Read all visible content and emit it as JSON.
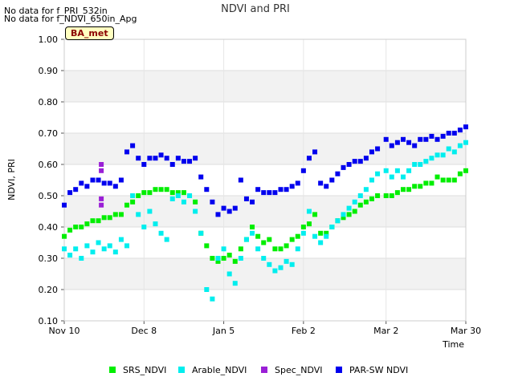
{
  "notes": [
    "No data for f_PRI_532in",
    "No data for f_NDVI_650in_Apg"
  ],
  "site_label": "BA_met",
  "colors": {
    "SRS_NDVI": "#00ee00",
    "Arable_NDVI": "#00eeee",
    "Spec_NDVI": "#9a1fd6",
    "PAR-SW NDVI": "#0000ee"
  },
  "chart_data": {
    "type": "scatter",
    "title": "NDVI and PRI",
    "xlabel": "Time",
    "ylabel": "NDVI, PRI",
    "x_ticks": [
      "Nov 10",
      "Dec 8",
      "Jan 5",
      "Feb 2",
      "Mar 2",
      "Mar 30"
    ],
    "x_range": [
      "Nov 10",
      "Mar 30"
    ],
    "ylim": [
      0.1,
      1.0
    ],
    "y_ticks": [
      "0.10",
      "0.20",
      "0.30",
      "0.40",
      "0.50",
      "0.60",
      "0.70",
      "0.80",
      "0.90",
      "1.00"
    ],
    "grid": true,
    "legend_position": "bottom",
    "series": [
      {
        "name": "SRS_NDVI",
        "points": [
          [
            "Nov 10",
            0.37
          ],
          [
            "Nov 12",
            0.39
          ],
          [
            "Nov 14",
            0.4
          ],
          [
            "Nov 16",
            0.4
          ],
          [
            "Nov 18",
            0.41
          ],
          [
            "Nov 20",
            0.42
          ],
          [
            "Nov 22",
            0.42
          ],
          [
            "Nov 24",
            0.43
          ],
          [
            "Nov 26",
            0.43
          ],
          [
            "Nov 28",
            0.44
          ],
          [
            "Nov 30",
            0.44
          ],
          [
            "Dec 2",
            0.47
          ],
          [
            "Dec 4",
            0.48
          ],
          [
            "Dec 6",
            0.5
          ],
          [
            "Dec 8",
            0.51
          ],
          [
            "Dec 10",
            0.51
          ],
          [
            "Dec 12",
            0.52
          ],
          [
            "Dec 14",
            0.52
          ],
          [
            "Dec 16",
            0.52
          ],
          [
            "Dec 18",
            0.51
          ],
          [
            "Dec 20",
            0.51
          ],
          [
            "Dec 22",
            0.51
          ],
          [
            "Dec 24",
            0.5
          ],
          [
            "Dec 26",
            0.48
          ],
          [
            "Dec 28",
            0.38
          ],
          [
            "Dec 30",
            0.34
          ],
          [
            "Jan 1",
            0.3
          ],
          [
            "Jan 3",
            0.29
          ],
          [
            "Jan 5",
            0.3
          ],
          [
            "Jan 7",
            0.31
          ],
          [
            "Jan 9",
            0.29
          ],
          [
            "Jan 11",
            0.33
          ],
          [
            "Jan 13",
            0.36
          ],
          [
            "Jan 15",
            0.4
          ],
          [
            "Jan 17",
            0.37
          ],
          [
            "Jan 19",
            0.35
          ],
          [
            "Jan 21",
            0.36
          ],
          [
            "Jan 23",
            0.33
          ],
          [
            "Jan 25",
            0.33
          ],
          [
            "Jan 27",
            0.34
          ],
          [
            "Jan 29",
            0.36
          ],
          [
            "Jan 31",
            0.37
          ],
          [
            "Feb 2",
            0.4
          ],
          [
            "Feb 4",
            0.41
          ],
          [
            "Feb 6",
            0.44
          ],
          [
            "Feb 8",
            0.38
          ],
          [
            "Feb 10",
            0.38
          ],
          [
            "Feb 12",
            0.4
          ],
          [
            "Feb 14",
            0.42
          ],
          [
            "Feb 16",
            0.43
          ],
          [
            "Feb 18",
            0.44
          ],
          [
            "Feb 20",
            0.45
          ],
          [
            "Feb 22",
            0.47
          ],
          [
            "Feb 24",
            0.48
          ],
          [
            "Feb 26",
            0.49
          ],
          [
            "Feb 28",
            0.5
          ],
          [
            "Mar 2",
            0.5
          ],
          [
            "Mar 4",
            0.5
          ],
          [
            "Mar 6",
            0.51
          ],
          [
            "Mar 8",
            0.52
          ],
          [
            "Mar 10",
            0.52
          ],
          [
            "Mar 12",
            0.53
          ],
          [
            "Mar 14",
            0.53
          ],
          [
            "Mar 16",
            0.54
          ],
          [
            "Mar 18",
            0.54
          ],
          [
            "Mar 20",
            0.56
          ],
          [
            "Mar 22",
            0.55
          ],
          [
            "Mar 24",
            0.55
          ],
          [
            "Mar 26",
            0.55
          ],
          [
            "Mar 28",
            0.57
          ],
          [
            "Mar 30",
            0.58
          ]
        ]
      },
      {
        "name": "Arable_NDVI",
        "points": [
          [
            "Nov 10",
            0.33
          ],
          [
            "Nov 12",
            0.31
          ],
          [
            "Nov 14",
            0.33
          ],
          [
            "Nov 16",
            0.3
          ],
          [
            "Nov 18",
            0.34
          ],
          [
            "Nov 20",
            0.32
          ],
          [
            "Nov 22",
            0.35
          ],
          [
            "Nov 24",
            0.33
          ],
          [
            "Nov 26",
            0.34
          ],
          [
            "Nov 28",
            0.32
          ],
          [
            "Nov 30",
            0.36
          ],
          [
            "Dec 2",
            0.34
          ],
          [
            "Dec 4",
            0.5
          ],
          [
            "Dec 6",
            0.44
          ],
          [
            "Dec 8",
            0.4
          ],
          [
            "Dec 10",
            0.45
          ],
          [
            "Dec 12",
            0.41
          ],
          [
            "Dec 14",
            0.38
          ],
          [
            "Dec 16",
            0.36
          ],
          [
            "Dec 18",
            0.49
          ],
          [
            "Dec 20",
            0.5
          ],
          [
            "Dec 22",
            0.48
          ],
          [
            "Dec 24",
            0.5
          ],
          [
            "Dec 26",
            0.45
          ],
          [
            "Dec 28",
            0.38
          ],
          [
            "Dec 30",
            0.2
          ],
          [
            "Jan 1",
            0.17
          ],
          [
            "Jan 3",
            0.3
          ],
          [
            "Jan 5",
            0.33
          ],
          [
            "Jan 7",
            0.25
          ],
          [
            "Jan 9",
            0.22
          ],
          [
            "Jan 11",
            0.3
          ],
          [
            "Jan 13",
            0.36
          ],
          [
            "Jan 15",
            0.38
          ],
          [
            "Jan 17",
            0.33
          ],
          [
            "Jan 19",
            0.3
          ],
          [
            "Jan 21",
            0.28
          ],
          [
            "Jan 23",
            0.26
          ],
          [
            "Jan 25",
            0.27
          ],
          [
            "Jan 27",
            0.29
          ],
          [
            "Jan 29",
            0.28
          ],
          [
            "Jan 31",
            0.33
          ],
          [
            "Feb 2",
            0.38
          ],
          [
            "Feb 4",
            0.45
          ],
          [
            "Feb 6",
            0.37
          ],
          [
            "Feb 8",
            0.35
          ],
          [
            "Feb 10",
            0.37
          ],
          [
            "Feb 12",
            0.4
          ],
          [
            "Feb 14",
            0.42
          ],
          [
            "Feb 16",
            0.44
          ],
          [
            "Feb 18",
            0.46
          ],
          [
            "Feb 20",
            0.48
          ],
          [
            "Feb 22",
            0.5
          ],
          [
            "Feb 24",
            0.52
          ],
          [
            "Feb 26",
            0.55
          ],
          [
            "Feb 28",
            0.57
          ],
          [
            "Mar 2",
            0.58
          ],
          [
            "Mar 4",
            0.56
          ],
          [
            "Mar 6",
            0.58
          ],
          [
            "Mar 8",
            0.56
          ],
          [
            "Mar 10",
            0.58
          ],
          [
            "Mar 12",
            0.6
          ],
          [
            "Mar 14",
            0.6
          ],
          [
            "Mar 16",
            0.61
          ],
          [
            "Mar 18",
            0.62
          ],
          [
            "Mar 20",
            0.63
          ],
          [
            "Mar 22",
            0.63
          ],
          [
            "Mar 24",
            0.65
          ],
          [
            "Mar 26",
            0.64
          ],
          [
            "Mar 28",
            0.66
          ],
          [
            "Mar 30",
            0.67
          ]
        ]
      },
      {
        "name": "Spec_NDVI",
        "points": [
          [
            "Nov 23",
            0.6
          ],
          [
            "Nov 23",
            0.58
          ],
          [
            "Nov 23",
            0.49
          ],
          [
            "Nov 23",
            0.47
          ]
        ]
      },
      {
        "name": "PAR-SW NDVI",
        "points": [
          [
            "Nov 10",
            0.47
          ],
          [
            "Nov 12",
            0.51
          ],
          [
            "Nov 14",
            0.52
          ],
          [
            "Nov 16",
            0.54
          ],
          [
            "Nov 18",
            0.53
          ],
          [
            "Nov 20",
            0.55
          ],
          [
            "Nov 22",
            0.55
          ],
          [
            "Nov 24",
            0.54
          ],
          [
            "Nov 26",
            0.54
          ],
          [
            "Nov 28",
            0.53
          ],
          [
            "Nov 30",
            0.55
          ],
          [
            "Dec 2",
            0.64
          ],
          [
            "Dec 4",
            0.66
          ],
          [
            "Dec 6",
            0.62
          ],
          [
            "Dec 8",
            0.6
          ],
          [
            "Dec 10",
            0.62
          ],
          [
            "Dec 12",
            0.62
          ],
          [
            "Dec 14",
            0.63
          ],
          [
            "Dec 16",
            0.62
          ],
          [
            "Dec 18",
            0.6
          ],
          [
            "Dec 20",
            0.62
          ],
          [
            "Dec 22",
            0.61
          ],
          [
            "Dec 24",
            0.61
          ],
          [
            "Dec 26",
            0.62
          ],
          [
            "Dec 28",
            0.56
          ],
          [
            "Dec 30",
            0.52
          ],
          [
            "Jan 1",
            0.48
          ],
          [
            "Jan 3",
            0.44
          ],
          [
            "Jan 5",
            0.46
          ],
          [
            "Jan 7",
            0.45
          ],
          [
            "Jan 9",
            0.46
          ],
          [
            "Jan 11",
            0.55
          ],
          [
            "Jan 13",
            0.49
          ],
          [
            "Jan 15",
            0.48
          ],
          [
            "Jan 17",
            0.52
          ],
          [
            "Jan 19",
            0.51
          ],
          [
            "Jan 21",
            0.51
          ],
          [
            "Jan 23",
            0.51
          ],
          [
            "Jan 25",
            0.52
          ],
          [
            "Jan 27",
            0.52
          ],
          [
            "Jan 29",
            0.53
          ],
          [
            "Jan 31",
            0.54
          ],
          [
            "Feb 2",
            0.58
          ],
          [
            "Feb 4",
            0.62
          ],
          [
            "Feb 6",
            0.64
          ],
          [
            "Feb 8",
            0.54
          ],
          [
            "Feb 10",
            0.53
          ],
          [
            "Feb 12",
            0.55
          ],
          [
            "Feb 14",
            0.57
          ],
          [
            "Feb 16",
            0.59
          ],
          [
            "Feb 18",
            0.6
          ],
          [
            "Feb 20",
            0.61
          ],
          [
            "Feb 22",
            0.61
          ],
          [
            "Feb 24",
            0.62
          ],
          [
            "Feb 26",
            0.64
          ],
          [
            "Feb 28",
            0.65
          ],
          [
            "Mar 2",
            0.68
          ],
          [
            "Mar 4",
            0.66
          ],
          [
            "Mar 6",
            0.67
          ],
          [
            "Mar 8",
            0.68
          ],
          [
            "Mar 10",
            0.67
          ],
          [
            "Mar 12",
            0.66
          ],
          [
            "Mar 14",
            0.68
          ],
          [
            "Mar 16",
            0.68
          ],
          [
            "Mar 18",
            0.69
          ],
          [
            "Mar 20",
            0.68
          ],
          [
            "Mar 22",
            0.69
          ],
          [
            "Mar 24",
            0.7
          ],
          [
            "Mar 26",
            0.7
          ],
          [
            "Mar 28",
            0.71
          ],
          [
            "Mar 30",
            0.72
          ]
        ]
      }
    ]
  }
}
